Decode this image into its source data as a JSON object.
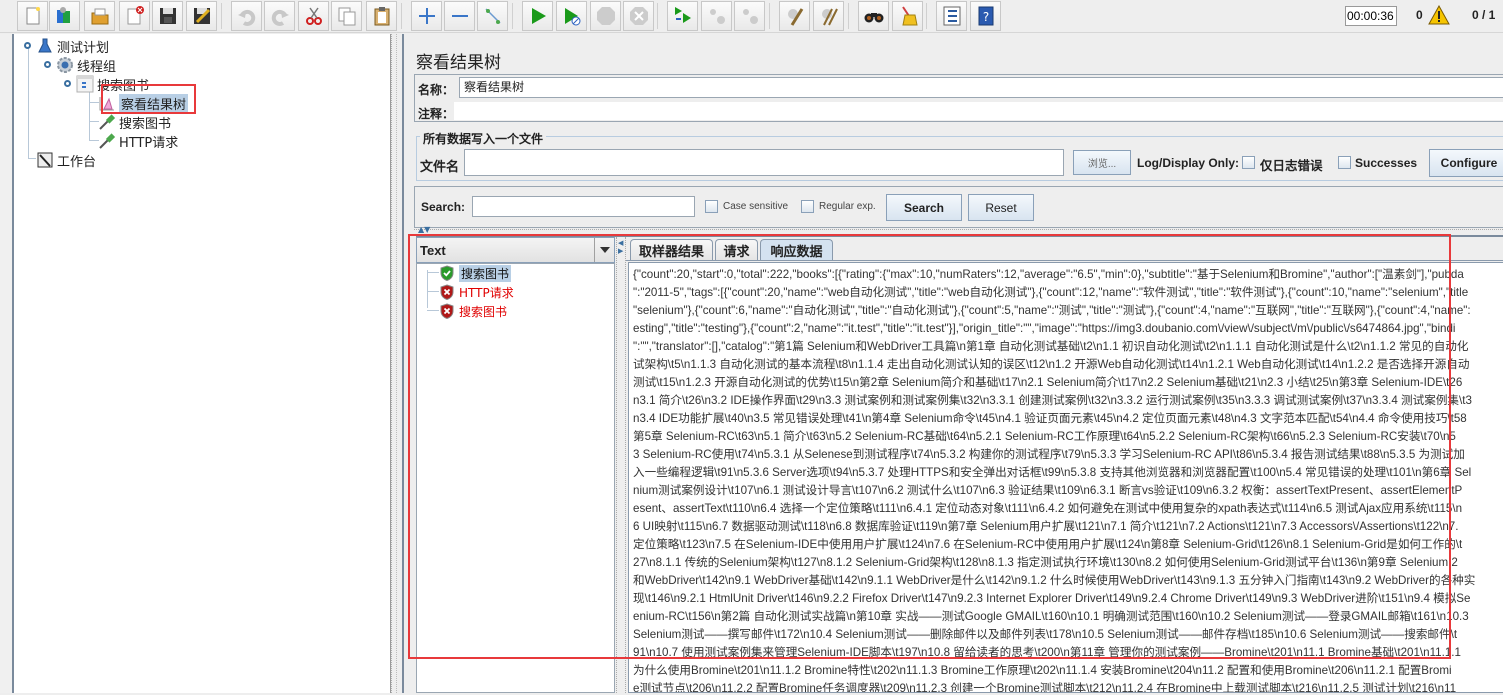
{
  "toolbar": {
    "buttons": [
      {
        "name": "new-icon"
      },
      {
        "name": "templates-icon"
      },
      {
        "name": "open-icon"
      },
      {
        "name": "close-icon"
      },
      {
        "name": "save-icon"
      },
      {
        "name": "save-as-icon"
      },
      {
        "name": "undo-icon"
      },
      {
        "name": "redo-icon"
      },
      {
        "name": "cut-icon"
      },
      {
        "name": "copy-icon"
      },
      {
        "name": "paste-icon"
      },
      {
        "name": "expand-icon"
      },
      {
        "name": "collapse-icon"
      },
      {
        "name": "toggle-icon"
      },
      {
        "name": "start-icon"
      },
      {
        "name": "start-no-pause-icon"
      },
      {
        "name": "stop-icon"
      },
      {
        "name": "shutdown-icon"
      },
      {
        "name": "remote-start-icon"
      },
      {
        "name": "remote-stop-icon"
      },
      {
        "name": "remote-shutdown-icon"
      },
      {
        "name": "clear-icon"
      },
      {
        "name": "clear-all-icon"
      },
      {
        "name": "search-binoculars-icon"
      },
      {
        "name": "reset-search-broom-icon"
      },
      {
        "name": "function-helper-icon"
      },
      {
        "name": "help-icon"
      }
    ],
    "timer": "00:00:36",
    "error_count": "0",
    "threads": "0 / 1"
  },
  "tree": {
    "items": [
      {
        "label": "测试计划",
        "icon": "test-plan-icon"
      },
      {
        "label": "线程组",
        "icon": "thread-group-icon"
      },
      {
        "label": "搜索图书",
        "icon": "transaction-controller-icon"
      },
      {
        "label": "察看结果树",
        "icon": "listener-icon",
        "selected": true
      },
      {
        "label": "搜索图书",
        "icon": "sampler-pipette-icon"
      },
      {
        "label": "HTTP请求",
        "icon": "sampler-pipette-icon"
      },
      {
        "label": "工作台",
        "icon": "workbench-icon"
      }
    ]
  },
  "panel": {
    "title": "察看结果树",
    "name_label": "名称：",
    "name_value": "察看结果树",
    "comment_label": "注释：",
    "comment_value": "",
    "file_group_title": "所有数据写入一个文件",
    "filename_label": "文件名",
    "filename_value": "",
    "browse_label": "浏览...",
    "log_display_label": "Log/Display Only:",
    "errors_only_label": "仅日志错误",
    "successes_label": "Successes",
    "configure_label": "Configure",
    "search_label": "Search:",
    "search_value": "",
    "case_sensitive_label": "Case sensitive",
    "regex_label": "Regular exp.",
    "search_button": "Search",
    "reset_button": "Reset"
  },
  "results": {
    "renderer": "Text",
    "samples": [
      {
        "label": "搜索图书",
        "status": "success"
      },
      {
        "label": "HTTP请求",
        "status": "error"
      },
      {
        "label": "搜索图书",
        "status": "error"
      }
    ],
    "tabs": [
      {
        "label": "取样器结果",
        "active": false
      },
      {
        "label": "请求",
        "active": false
      },
      {
        "label": "响应数据",
        "active": true
      }
    ],
    "response_lines": [
      "{\"count\":20,\"start\":0,\"total\":222,\"books\":[{\"rating\":{\"max\":10,\"numRaters\":12,\"average\":\"6.5\",\"min\":0},\"subtitle\":\"基于Selenium和Bromine\",\"author\":[\"温素剑\"],\"pubda",
      "\":\"2011-5\",\"tags\":[{\"count\":20,\"name\":\"web自动化测试\",\"title\":\"web自动化测试\"},{\"count\":12,\"name\":\"软件测试\",\"title\":\"软件测试\"},{\"count\":10,\"name\":\"selenium\",\"title",
      "\"selenium\"},{\"count\":6,\"name\":\"自动化测试\",\"title\":\"自动化测试\"},{\"count\":5,\"name\":\"测试\",\"title\":\"测试\"},{\"count\":4,\"name\":\"互联网\",\"title\":\"互联网\"},{\"count\":4,\"name\":",
      "esting\",\"title\":\"testing\"},{\"count\":2,\"name\":\"it.test\",\"title\":\"it.test\"}],\"origin_title\":\"\",\"image\":\"https://img3.doubanio.com\\/view\\/subject\\/m\\/public\\/s6474864.jpg\",\"bindi",
      "\":\"\",\"translator\":[],\"catalog\":\"第1篇 Selenium和WebDriver工具篇\\n第1章 自动化测试基础\\t2\\n1.1 初识自动化测试\\t2\\n1.1.1 自动化测试是什么\\t2\\n1.1.2 常见的自动化",
      "试架构\\t5\\n1.1.3 自动化测试的基本流程\\t8\\n1.1.4 走出自动化测试认知的误区\\t12\\n1.2 开源Web自动化测试\\t14\\n1.2.1 Web自动化测试\\t14\\n1.2.2 是否选择开源自动",
      "测试\\t15\\n1.2.3 开源自动化测试的优势\\t15\\n第2章 Selenium简介和基础\\t17\\n2.1 Selenium简介\\t17\\n2.2 Selenium基础\\t21\\n2.3 小结\\t25\\n第3章 Selenium-IDE\\t26",
      "n3.1 简介\\t26\\n3.2 IDE操作界面\\t29\\n3.3 测试案例和测试案例集\\t32\\n3.3.1 创建测试案例\\t32\\n3.3.2 运行测试案例\\t35\\n3.3.3 调试测试案例\\t37\\n3.3.4 测试案例集\\t3",
      "n3.4 IDE功能扩展\\t40\\n3.5 常见错误处理\\t41\\n第4章 Selenium命令\\t45\\n4.1 验证页面元素\\t45\\n4.2 定位页面元素\\t48\\n4.3 文字范本匹配\\t54\\n4.4 命令使用技巧\\t58",
      "第5章 Selenium-RC\\t63\\n5.1 简介\\t63\\n5.2 Selenium-RC基础\\t64\\n5.2.1 Selenium-RC工作原理\\t64\\n5.2.2 Selenium-RC架构\\t66\\n5.2.3 Selenium-RC安装\\t70\\n5",
      "3 Selenium-RC使用\\t74\\n5.3.1 从Selenese到测试程序\\t74\\n5.3.2 构建你的测试程序\\t79\\n5.3.3 学习Selenium-RC API\\t86\\n5.3.4 报告测试结果\\t88\\n5.3.5 为测试加",
      "入一些编程逻辑\\t91\\n5.3.6 Server选项\\t94\\n5.3.7 处理HTTPS和安全弹出对话框\\t99\\n5.3.8 支持其他浏览器和浏览器配置\\t100\\n5.4 常见错误的处理\\t101\\n第6章 Sel",
      "nium测试案例设计\\t107\\n6.1 测试设计导言\\t107\\n6.2 测试什么\\t107\\n6.3 验证结果\\t109\\n6.3.1 断言vs验证\\t109\\n6.3.2 权衡：assertTextPresent、assertElementP",
      "esent、assertText\\t110\\n6.4 选择一个定位策略\\t111\\n6.4.1 定位动态对象\\t111\\n6.4.2 如何避免在测试中使用复杂的xpath表达式\\t114\\n6.5 测试Ajax应用系统\\t115\\n",
      "6 UI映射\\t115\\n6.7 数据驱动测试\\t118\\n6.8 数据库验证\\t119\\n第7章 Selenium用户扩展\\t121\\n7.1 简介\\t121\\n7.2 Actions\\t121\\n7.3 Accessors\\/Assertions\\t122\\n7.",
      "定位策略\\t123\\n7.5 在Selenium-IDE中使用用户扩展\\t124\\n7.6 在Selenium-RC中使用用户扩展\\t124\\n第8章 Selenium-Grid\\t126\\n8.1 Selenium-Grid是如何工作的\\t",
      "27\\n8.1.1 传统的Selenium架构\\t127\\n8.1.2 Selenium-Grid架构\\t128\\n8.1.3 指定测试执行环境\\t130\\n8.2 如何使用Selenium-Grid测试平台\\t136\\n第9章 Selenium 2",
      "和WebDriver\\t142\\n9.1 WebDriver基础\\t142\\n9.1.1 WebDriver是什么\\t142\\n9.1.2 什么时候使用WebDriver\\t143\\n9.1.3 五分钟入门指南\\t143\\n9.2 WebDriver的各种实",
      "现\\t146\\n9.2.1 HtmlUnit Driver\\t146\\n9.2.2 Firefox Driver\\t147\\n9.2.3 Internet Explorer Driver\\t149\\n9.2.4 Chrome Driver\\t149\\n9.3 WebDriver进阶\\t151\\n9.4 模拟Se",
      "enium-RC\\t156\\n第2篇 自动化测试实战篇\\n第10章 实战——测试Google GMAIL\\t160\\n10.1 明确测试范围\\t160\\n10.2 Selenium测试——登录GMAIL邮箱\\t161\\n10.3",
      "Selenium测试——撰写邮件\\t172\\n10.4 Selenium测试——删除邮件以及邮件列表\\t178\\n10.5 Selenium测试——邮件存档\\t185\\n10.6 Selenium测试——搜索邮件\\t",
      "91\\n10.7 使用测试案例集来管理Selenium-IDE脚本\\t197\\n10.8 留给读者的思考\\t200\\n第11章 管理你的测试案例——Bromine\\t201\\n11.1 Bromine基础\\t201\\n11.1.1",
      "为什么使用Bromine\\t201\\n11.1.2 Bromine特性\\t202\\n11.1.3 Bromine工作原理\\t202\\n11.1.4 安装Bromine\\t204\\n11.2 配置和使用Bromine\\t206\\n11.2.1 配置Bromi",
      "e测试节点\\t206\\n11.2.2 配置Bromine任务调度器\\t209\\n11.2.3 创建一个Bromine测试脚本\\t212\\n11.2.4 在Bromine中上载测试脚本\\t216\\n11.2.5 测试计划\\t216\\n11"
    ]
  },
  "colors": {
    "annotation_red": "#e8393b",
    "selection_blue": "#b8cfe5",
    "error_text": "#e00000"
  }
}
